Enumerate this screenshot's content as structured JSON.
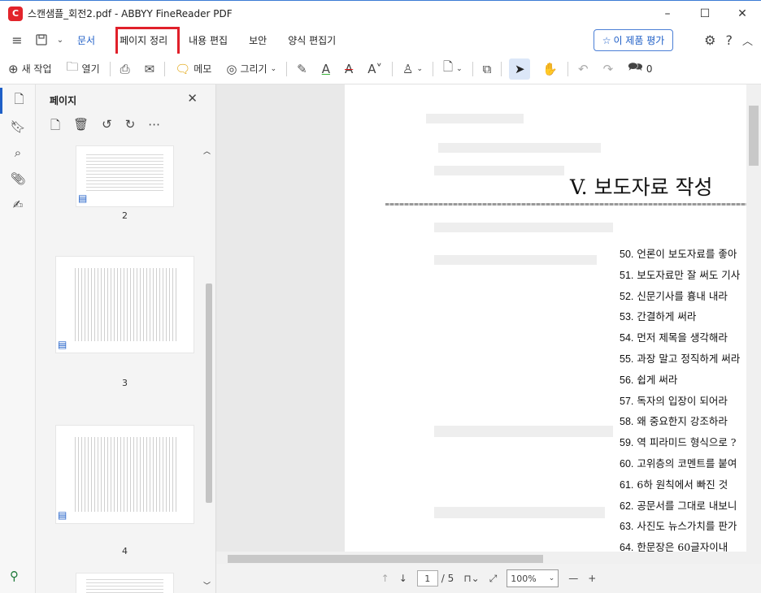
{
  "window": {
    "title": "스캔샘플_회전2.pdf - ABBYY FineReader PDF",
    "minimize": "–",
    "maximize": "☐",
    "close": "✕"
  },
  "menu": {
    "tabs": [
      "문서",
      "페이지 정리",
      "내용 편집",
      "보안",
      "양식 편집기"
    ],
    "active_tab": "문서",
    "rate_label": "이 제품 평가"
  },
  "toolbar": {
    "new_task": "새 작업",
    "open": "열기",
    "memo": "메모",
    "draw": "그리기",
    "comment_count": "0"
  },
  "panel": {
    "title": "페이지",
    "pages": [
      "2",
      "3",
      "4"
    ]
  },
  "document": {
    "heading": "V. 보도자료 작성",
    "toc": [
      {
        "num": "50.",
        "text": "언론이 보도자료를 좋아"
      },
      {
        "num": "51.",
        "text": "보도자료만 잘 써도 기사"
      },
      {
        "num": "52.",
        "text": "신문기사를 흉내 내라"
      },
      {
        "num": "53.",
        "text": "간결하게 써라"
      },
      {
        "num": "54.",
        "text": "먼저 제목을 생각해라"
      },
      {
        "num": "55.",
        "text": "과장 말고 정직하게 써라"
      },
      {
        "num": "56.",
        "text": "쉽게 써라"
      },
      {
        "num": "57.",
        "text": "독자의 입장이 되어라"
      },
      {
        "num": "58.",
        "text": "왜 중요한지 강조하라"
      },
      {
        "num": "59.",
        "text": "역 피라미드 형식으로 ?"
      },
      {
        "num": "60.",
        "text": "고위층의 코멘트를 붙여"
      },
      {
        "num": "61.",
        "text": "6하 원칙에서 빠진 것"
      },
      {
        "num": "62.",
        "text": "공문서를 그대로 내보니"
      },
      {
        "num": "63.",
        "text": "사진도 뉴스가치를 판가"
      },
      {
        "num": "64.",
        "text": "한문장은 60글자이내"
      }
    ]
  },
  "status": {
    "current_page": "1",
    "total_pages": "/ 5",
    "zoom": "100%"
  }
}
